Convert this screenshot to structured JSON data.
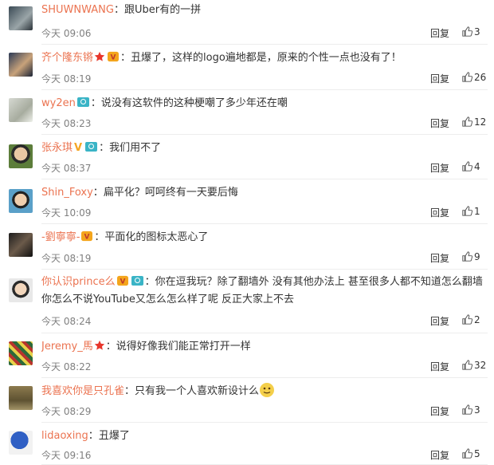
{
  "reply_label": "回复",
  "colors": {
    "username": "#eb7350",
    "time": "#808080",
    "text": "#333333",
    "divider": "#ededed"
  },
  "comments": [
    {
      "user": "SHUWNWANG",
      "text": "跟Uber有的一拼",
      "time": "今天 09:06",
      "likes": "3",
      "icons": []
    },
    {
      "user": "齐个隆东锵",
      "text": "丑爆了，这样的logo遍地都是，原来的个性一点也没有了！",
      "time": "今天 08:19",
      "likes": "26",
      "icons": [
        "star-icon",
        "vip-badge-icon"
      ]
    },
    {
      "user": "wy2en",
      "text": "说没有这软件的这种梗嘲了多少年还在嘲",
      "time": "今天 08:23",
      "likes": "12",
      "icons": [
        "camera-badge-icon"
      ]
    },
    {
      "user": "张永琪",
      "text": "我们用不了",
      "time": "今天 08:37",
      "likes": "4",
      "icons": [
        "verified-v-icon",
        "camera-badge-icon"
      ]
    },
    {
      "user": "Shin_Foxy",
      "text": "扁平化？呵呵终有一天要后悔",
      "time": "今天 10:09",
      "likes": "1",
      "icons": []
    },
    {
      "user": "-劉寧寧-",
      "text": "平面化的图标太恶心了",
      "time": "今天 08:19",
      "likes": "9",
      "icons": [
        "vip-badge-icon"
      ]
    },
    {
      "user": "你认识prince么",
      "text": "你在逗我玩？除了翻墙外 没有其他办法上 甚至很多人都不知道怎么翻墙 你怎么不说YouTube又怎么怎么样了呢 反正大家上不去",
      "time": "今天 08:24",
      "likes": "2",
      "icons": [
        "vip-badge-icon",
        "camera-badge-icon"
      ]
    },
    {
      "user": "Jeremy_馬",
      "text": "说得好像我们能正常打开一样",
      "time": "今天 08:22",
      "likes": "32",
      "icons": [
        "star-icon"
      ]
    },
    {
      "user": "我喜欢你是只孔雀",
      "text": "只有我一个人喜欢新设计么",
      "time": "今天 08:29",
      "likes": "3",
      "icons": [],
      "trailing_emoji": "smirk-face-emoji"
    },
    {
      "user": "lidaoxing",
      "text": "丑爆了",
      "time": "今天 09:16",
      "likes": "5",
      "icons": []
    }
  ]
}
